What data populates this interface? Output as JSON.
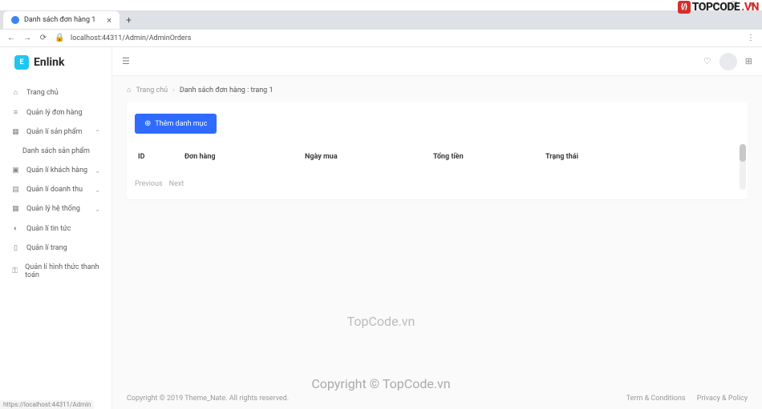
{
  "browser": {
    "tab_title": "Danh sách đơn hàng 1",
    "url": "localhost:44311/Admin/AdminOrders",
    "status_url": "https://localhost:44311/Admin"
  },
  "watermark": {
    "top_brand_pre": "TOPCODE",
    "top_brand_suf": ".VN",
    "center": "TopCode.vn",
    "copy": "Copyright © TopCode.vn"
  },
  "brand": {
    "mark": "E",
    "name": "Enlink"
  },
  "nav": {
    "home": "Trang chủ",
    "orders": "Quản lý đơn hàng",
    "products": "Quản lí sản phẩm",
    "products_sub": "Danh sách sản phẩm",
    "customers": "Quản lí khách hàng",
    "revenue": "Quản lí doanh thu",
    "system": "Quản lý hệ thống",
    "news": "Quản lí tin tức",
    "pages": "Quản lí trang",
    "payments": "Quản lí hình thức thanh toán"
  },
  "breadcrumb": {
    "home": "Trang chủ",
    "current": "Danh sách đơn hàng : trang 1"
  },
  "actions": {
    "add": "Thêm danh mục"
  },
  "table": {
    "headers": {
      "id": "ID",
      "order": "Đơn hàng",
      "date": "Ngày mua",
      "total": "Tổng tiền",
      "status": "Trạng thái"
    }
  },
  "pagination": {
    "prev": "Previous",
    "next": "Next"
  },
  "footer": {
    "copyright": "Copyright © 2019 Theme_Nate. All rights reserved.",
    "terms": "Term & Conditions",
    "privacy": "Privacy & Policy"
  }
}
